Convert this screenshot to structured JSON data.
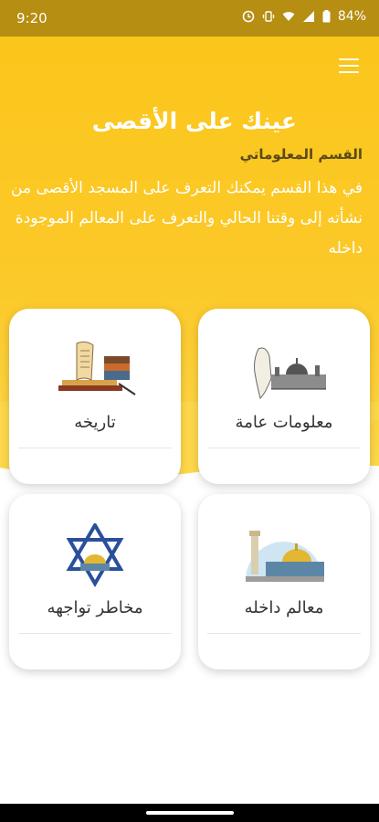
{
  "status_bar": {
    "time": "9:20",
    "battery": "84%"
  },
  "header": {
    "title": "عينك على الأقصى",
    "subtitle": "القسم المعلوماتي",
    "description": "في هذا القسم يمكنك التعرف على المسجد الأقصى من نشأته إلى وقتنا الحالي والتعرف على المعالم الموجودة داخله"
  },
  "cards": [
    {
      "label": "معلومات عامة",
      "image": "jerusalem-map-illustration"
    },
    {
      "label": "تاريخه",
      "image": "books-and-scroll-illustration"
    },
    {
      "label": "معالم داخله",
      "image": "dome-of-the-rock-illustration"
    },
    {
      "label": "مخاطر تواجهه",
      "image": "star-over-dome-illustration"
    }
  ],
  "icons": {
    "menu": "hamburger-menu-icon",
    "alarm": "alarm-icon",
    "vibrate": "vibrate-icon",
    "wifi": "wifi-icon",
    "signal": "signal-icon",
    "battery": "battery-icon"
  },
  "colors": {
    "header": "#fbc61b",
    "status_bar": "#b58e12"
  }
}
